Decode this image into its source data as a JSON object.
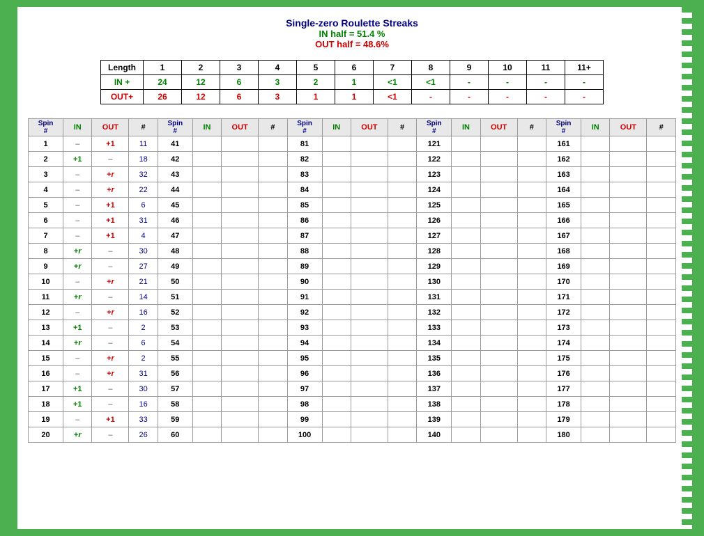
{
  "title": {
    "main": "Single-zero Roulette Streaks",
    "in_half": "IN half = 51.4 %",
    "out_half": "OUT half = 48.6%"
  },
  "summary": {
    "headers": [
      "Length",
      "1",
      "2",
      "3",
      "4",
      "5",
      "6",
      "7",
      "8",
      "9",
      "10",
      "11",
      "11+"
    ],
    "in_row": [
      "IN +",
      "24",
      "12",
      "6",
      "3",
      "2",
      "1",
      "<1",
      "<1",
      "-",
      "-",
      "-",
      "-"
    ],
    "out_row": [
      "OUT+",
      "26",
      "12",
      "6",
      "3",
      "1",
      "1",
      "<1",
      "-",
      "-",
      "-",
      "-",
      "-"
    ]
  },
  "spin_table": {
    "col_headers": [
      "Spin #",
      "IN",
      "OUT",
      "#",
      "Spin #",
      "IN",
      "OUT",
      "#",
      "Spin #",
      "IN",
      "OUT",
      "#",
      "Spin #",
      "IN",
      "OUT",
      "#",
      "Spin #",
      "IN",
      "OUT",
      "#"
    ],
    "rows": [
      [
        1,
        "–",
        "+1",
        11,
        41,
        "",
        "",
        "",
        81,
        "",
        "",
        "",
        121,
        "",
        "",
        "",
        161,
        "",
        "",
        ""
      ],
      [
        2,
        "+1",
        "–",
        18,
        42,
        "",
        "",
        "",
        82,
        "",
        "",
        "",
        122,
        "",
        "",
        "",
        162,
        "",
        "",
        ""
      ],
      [
        3,
        "–",
        "+r",
        32,
        43,
        "",
        "",
        "",
        83,
        "",
        "",
        "",
        123,
        "",
        "",
        "",
        163,
        "",
        "",
        ""
      ],
      [
        4,
        "–",
        "+r",
        22,
        44,
        "",
        "",
        "",
        84,
        "",
        "",
        "",
        124,
        "",
        "",
        "",
        164,
        "",
        "",
        ""
      ],
      [
        5,
        "–",
        "+1",
        6,
        45,
        "",
        "",
        "",
        85,
        "",
        "",
        "",
        125,
        "",
        "",
        "",
        165,
        "",
        "",
        ""
      ],
      [
        6,
        "–",
        "+1",
        31,
        46,
        "",
        "",
        "",
        86,
        "",
        "",
        "",
        126,
        "",
        "",
        "",
        166,
        "",
        "",
        ""
      ],
      [
        7,
        "–",
        "+1",
        4,
        47,
        "",
        "",
        "",
        87,
        "",
        "",
        "",
        127,
        "",
        "",
        "",
        167,
        "",
        "",
        ""
      ],
      [
        8,
        "+r",
        "–",
        30,
        48,
        "",
        "",
        "",
        88,
        "",
        "",
        "",
        128,
        "",
        "",
        "",
        168,
        "",
        "",
        ""
      ],
      [
        9,
        "+r",
        "–",
        27,
        49,
        "",
        "",
        "",
        89,
        "",
        "",
        "",
        129,
        "",
        "",
        "",
        169,
        "",
        "",
        ""
      ],
      [
        10,
        "–",
        "+r",
        21,
        50,
        "",
        "",
        "",
        90,
        "",
        "",
        "",
        130,
        "",
        "",
        "",
        170,
        "",
        "",
        ""
      ],
      [
        11,
        "+r",
        "–",
        14,
        51,
        "",
        "",
        "",
        91,
        "",
        "",
        "",
        131,
        "",
        "",
        "",
        171,
        "",
        "",
        ""
      ],
      [
        12,
        "–",
        "+r",
        16,
        52,
        "",
        "",
        "",
        92,
        "",
        "",
        "",
        132,
        "",
        "",
        "",
        172,
        "",
        "",
        ""
      ],
      [
        13,
        "+1",
        "–",
        2,
        53,
        "",
        "",
        "",
        93,
        "",
        "",
        "",
        133,
        "",
        "",
        "",
        173,
        "",
        "",
        ""
      ],
      [
        14,
        "+r",
        "–",
        6,
        54,
        "",
        "",
        "",
        94,
        "",
        "",
        "",
        134,
        "",
        "",
        "",
        174,
        "",
        "",
        ""
      ],
      [
        15,
        "–",
        "+r",
        2,
        55,
        "",
        "",
        "",
        95,
        "",
        "",
        "",
        135,
        "",
        "",
        "",
        175,
        "",
        "",
        ""
      ],
      [
        16,
        "–",
        "+r",
        31,
        56,
        "",
        "",
        "",
        96,
        "",
        "",
        "",
        136,
        "",
        "",
        "",
        176,
        "",
        "",
        ""
      ],
      [
        17,
        "+1",
        "–",
        30,
        57,
        "",
        "",
        "",
        97,
        "",
        "",
        "",
        137,
        "",
        "",
        "",
        177,
        "",
        "",
        ""
      ],
      [
        18,
        "+1",
        "–",
        16,
        58,
        "",
        "",
        "",
        98,
        "",
        "",
        "",
        138,
        "",
        "",
        "",
        178,
        "",
        "",
        ""
      ],
      [
        19,
        "–",
        "+1",
        33,
        59,
        "",
        "",
        "",
        99,
        "",
        "",
        "",
        139,
        "",
        "",
        "",
        179,
        "",
        "",
        ""
      ],
      [
        20,
        "+r",
        "–",
        26,
        60,
        "",
        "",
        "",
        100,
        "",
        "",
        "",
        140,
        "",
        "",
        "",
        180,
        "",
        "",
        ""
      ]
    ]
  }
}
